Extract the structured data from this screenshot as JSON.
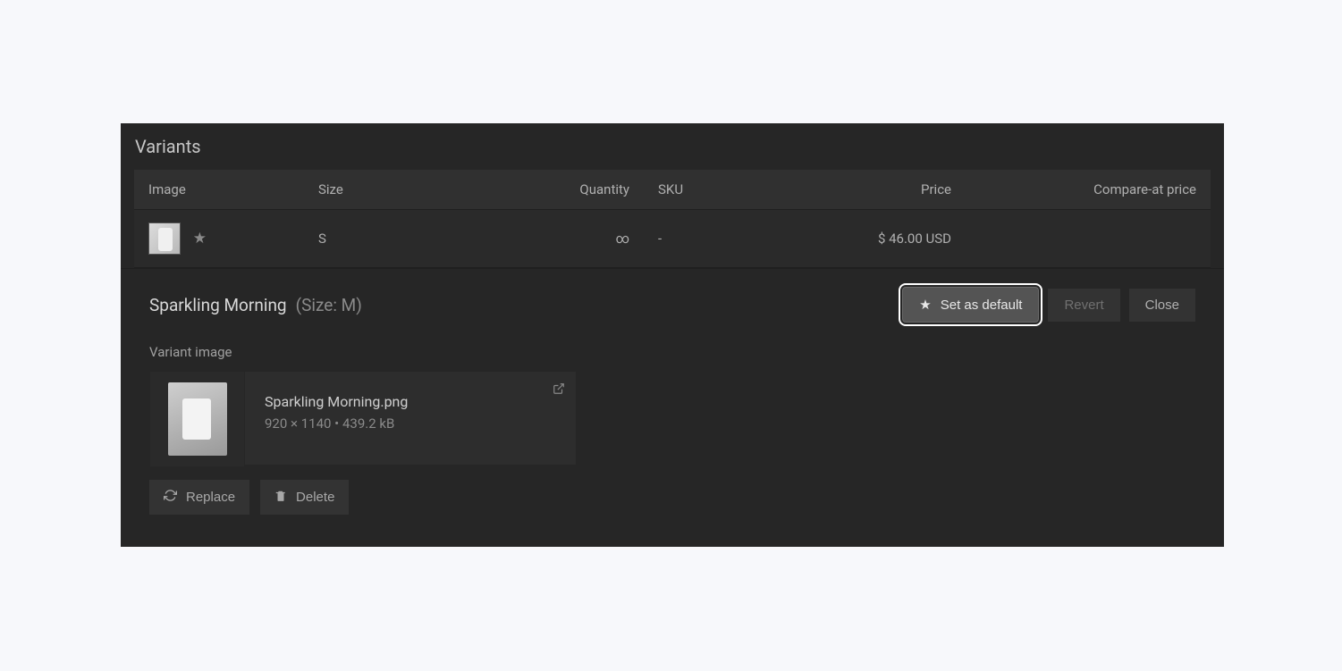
{
  "section_title": "Variants",
  "columns": {
    "image": "Image",
    "size": "Size",
    "quantity": "Quantity",
    "sku": "SKU",
    "price": "Price",
    "compare": "Compare-at price"
  },
  "row": {
    "size": "S",
    "quantity": "∞",
    "sku": "-",
    "price": "$ 46.00 USD",
    "compare": ""
  },
  "editor": {
    "name": "Sparkling Morning",
    "subtitle": "(Size: M)",
    "set_default": "Set as default",
    "revert": "Revert",
    "close": "Close",
    "image_section": "Variant image",
    "file_name": "Sparkling Morning.png",
    "file_meta": "920 × 1140 • 439.2 kB",
    "replace": "Replace",
    "delete": "Delete"
  }
}
